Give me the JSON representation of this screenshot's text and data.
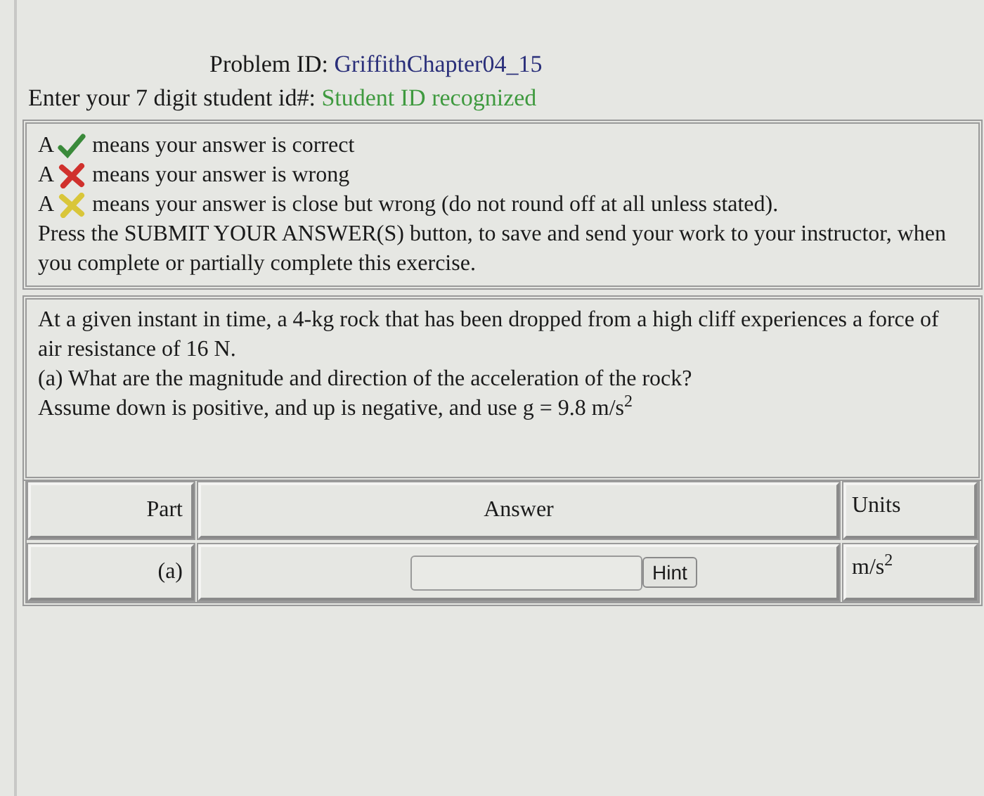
{
  "problem": {
    "label": "Problem ID:",
    "id": "GriffithChapter04_15"
  },
  "student": {
    "label": "Enter your 7 digit student id#:",
    "status": "Student ID recognized"
  },
  "legend": [
    {
      "prefix": "A",
      "kind": "correct",
      "text": "means your answer is correct"
    },
    {
      "prefix": "A",
      "kind": "wrong",
      "text": "means your answer is wrong"
    },
    {
      "prefix": "A",
      "kind": "close",
      "text": "means your answer is close but wrong (do not round off at all unless stated)."
    }
  ],
  "instructions": "Press the SUBMIT YOUR ANSWER(S) button, to save and send your work to your instructor, when you complete or partially complete this exercise.",
  "question": [
    "At a given instant in time, a 4-kg rock that has been dropped from a high cliff experiences a force of air resistance of 16 N.",
    "(a) What are the magnitude and direction of the acceleration of the rock?",
    "Assume down is positive, and up is negative, and use g = 9.8 m/s$^{2}$"
  ],
  "table": {
    "columns": [
      "Part",
      "Answer",
      "Units"
    ],
    "rows": [
      {
        "part": "(a)",
        "hint": "Hint",
        "units": "m/s$^{2}$"
      }
    ]
  }
}
